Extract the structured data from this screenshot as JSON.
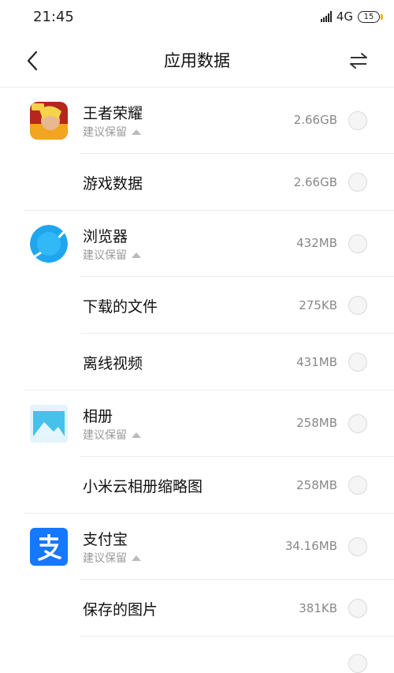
{
  "status": {
    "time": "21:45",
    "network": "4G",
    "battery": "15"
  },
  "header": {
    "title": "应用数据"
  },
  "rows": [
    {
      "type": "app",
      "icon": "honor-of-kings-icon",
      "title": "王者荣耀",
      "sub": "建议保留",
      "size": "2.66GB"
    },
    {
      "type": "item",
      "title": "游戏数据",
      "size": "2.66GB"
    },
    {
      "type": "app",
      "icon": "browser-icon",
      "title": "浏览器",
      "sub": "建议保留",
      "size": "432MB"
    },
    {
      "type": "item",
      "title": "下载的文件",
      "size": "275KB"
    },
    {
      "type": "item",
      "title": "离线视频",
      "size": "431MB"
    },
    {
      "type": "app",
      "icon": "gallery-icon",
      "title": "相册",
      "sub": "建议保留",
      "size": "258MB"
    },
    {
      "type": "item",
      "title": "小米云相册缩略图",
      "size": "258MB"
    },
    {
      "type": "app",
      "icon": "alipay-icon",
      "title": "支付宝",
      "sub": "建议保留",
      "size": "34.16MB"
    },
    {
      "type": "item",
      "title": "保存的图片",
      "size": "381KB"
    }
  ]
}
